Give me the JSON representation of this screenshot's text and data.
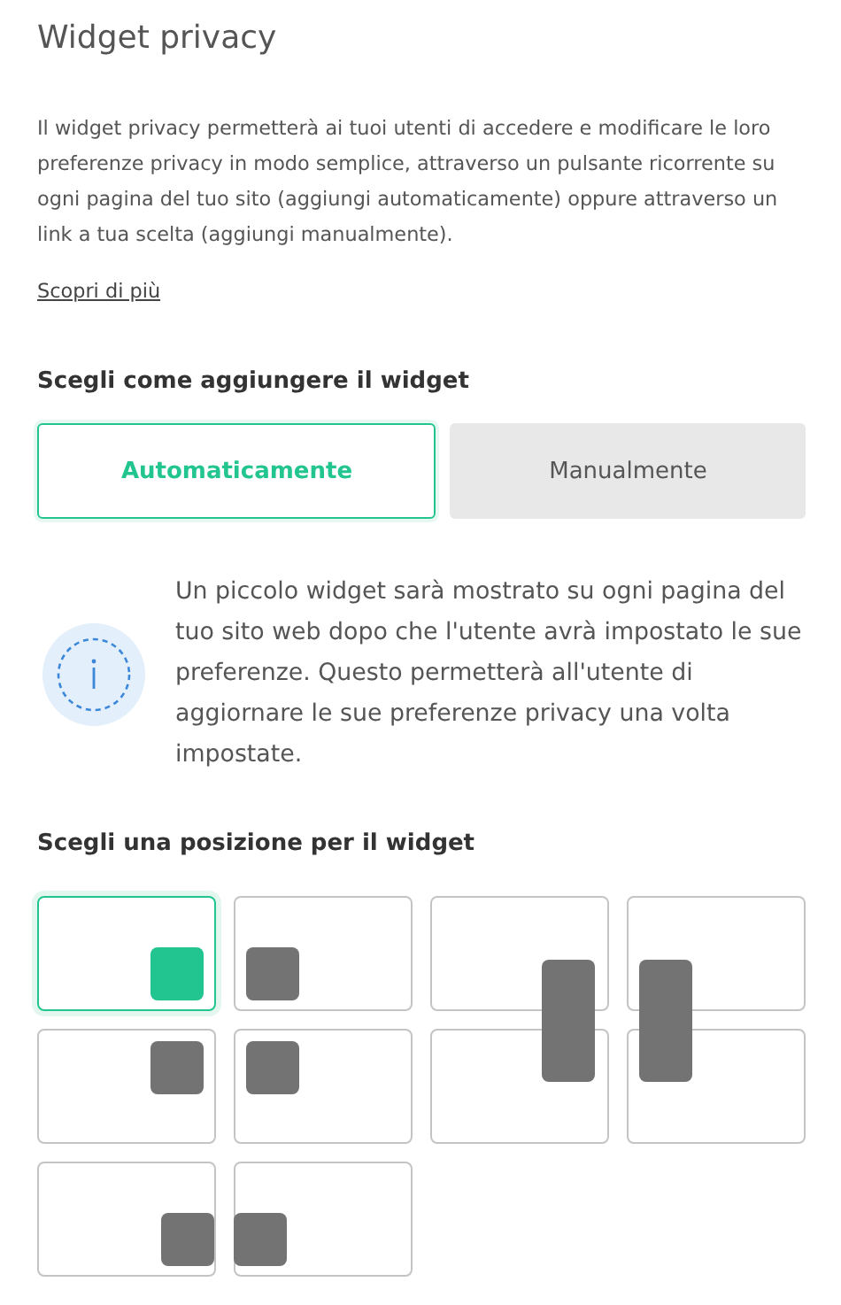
{
  "title": "Widget privacy",
  "description": "Il widget privacy permetterà ai tuoi utenti di accedere e modificare le loro preferenze privacy in modo semplice, attraverso un pulsante ricorrente su ogni pagina del tuo sito (aggiungi automaticamente) oppure attraverso un link a tua scelta (aggiungi manualmente).",
  "learn_more_link": "Scopri di più",
  "add_method": {
    "heading": "Scegli come aggiungere il widget",
    "options": [
      {
        "label": "Automaticamente",
        "selected": true
      },
      {
        "label": "Manualmente",
        "selected": false
      }
    ],
    "info": "Un piccolo widget sarà mostrato su ogni pagina del tuo sito web dopo che l'utente avrà impostato le sue preferenze. Questo permetterà all'utente di aggiornare le sue preferenze privacy una volta impostate."
  },
  "position": {
    "heading": "Scegli una posizione per il widget",
    "options": [
      {
        "kind": "bottomright",
        "selected": true
      },
      {
        "kind": "bottomleft",
        "selected": false
      },
      {
        "kind": "midright",
        "selected": false
      },
      {
        "kind": "midleft",
        "selected": false
      },
      {
        "kind": "topright",
        "selected": false
      },
      {
        "kind": "topleft",
        "selected": false
      },
      {
        "kind": "empty",
        "selected": false
      },
      {
        "kind": "empty",
        "selected": false
      },
      {
        "kind": "edgeright",
        "selected": false
      },
      {
        "kind": "edgeleft",
        "selected": false
      }
    ]
  }
}
